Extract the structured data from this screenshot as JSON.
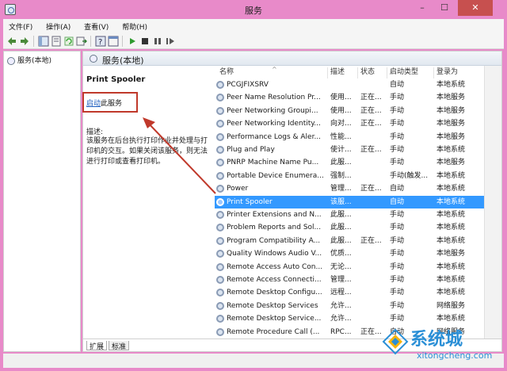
{
  "window": {
    "title": "服务",
    "min": "–",
    "max": "☐",
    "close": "✕"
  },
  "menu": [
    "文件(F)",
    "操作(A)",
    "查看(V)",
    "帮助(H)"
  ],
  "tree": {
    "root": "服务(本地)"
  },
  "main": {
    "header": "服务(本地)",
    "service_title": "Print Spooler",
    "start_link": "启动",
    "start_suffix": "此服务",
    "desc_label": "描述:",
    "desc_text": "该服务在后台执行打印作业并处理与打印机的交互。如果关闭该服务，则无法进行打印或查看打印机。"
  },
  "columns": [
    "名称",
    "描述",
    "状态",
    "启动类型",
    "登录为"
  ],
  "services": [
    {
      "name": "PCGJFIXSRV",
      "desc": "",
      "status": "",
      "start": "自动",
      "logon": "本地系统"
    },
    {
      "name": "Peer Name Resolution Pr...",
      "desc": "使用...",
      "status": "正在...",
      "start": "手动",
      "logon": "本地服务"
    },
    {
      "name": "Peer Networking Groupi...",
      "desc": "使用...",
      "status": "正在...",
      "start": "手动",
      "logon": "本地服务"
    },
    {
      "name": "Peer Networking Identity...",
      "desc": "向对...",
      "status": "正在...",
      "start": "手动",
      "logon": "本地服务"
    },
    {
      "name": "Performance Logs & Aler...",
      "desc": "性能...",
      "status": "",
      "start": "手动",
      "logon": "本地服务"
    },
    {
      "name": "Plug and Play",
      "desc": "使计...",
      "status": "正在...",
      "start": "手动",
      "logon": "本地系统"
    },
    {
      "name": "PNRP Machine Name Pu...",
      "desc": "此服...",
      "status": "",
      "start": "手动",
      "logon": "本地服务"
    },
    {
      "name": "Portable Device Enumera...",
      "desc": "强制...",
      "status": "",
      "start": "手动(触发...",
      "logon": "本地系统"
    },
    {
      "name": "Power",
      "desc": "管理...",
      "status": "正在...",
      "start": "自动",
      "logon": "本地系统"
    },
    {
      "name": "Print Spooler",
      "desc": "该服...",
      "status": "",
      "start": "自动",
      "logon": "本地系统",
      "selected": true
    },
    {
      "name": "Printer Extensions and N...",
      "desc": "此服...",
      "status": "",
      "start": "手动",
      "logon": "本地系统"
    },
    {
      "name": "Problem Reports and Sol...",
      "desc": "此服...",
      "status": "",
      "start": "手动",
      "logon": "本地系统"
    },
    {
      "name": "Program Compatibility A...",
      "desc": "此服...",
      "status": "正在...",
      "start": "手动",
      "logon": "本地系统"
    },
    {
      "name": "Quality Windows Audio V...",
      "desc": "优质...",
      "status": "",
      "start": "手动",
      "logon": "本地服务"
    },
    {
      "name": "Remote Access Auto Con...",
      "desc": "无论...",
      "status": "",
      "start": "手动",
      "logon": "本地系统"
    },
    {
      "name": "Remote Access Connecti...",
      "desc": "管理...",
      "status": "",
      "start": "手动",
      "logon": "本地系统"
    },
    {
      "name": "Remote Desktop Configu...",
      "desc": "远程...",
      "status": "",
      "start": "手动",
      "logon": "本地系统"
    },
    {
      "name": "Remote Desktop Services",
      "desc": "允许...",
      "status": "",
      "start": "手动",
      "logon": "网络服务"
    },
    {
      "name": "Remote Desktop Service...",
      "desc": "允许...",
      "status": "",
      "start": "手动",
      "logon": "本地系统"
    },
    {
      "name": "Remote Procedure Call (...",
      "desc": "RPC...",
      "status": "正在...",
      "start": "自动",
      "logon": "网络服务"
    }
  ],
  "tabs": [
    "扩展",
    "标准"
  ],
  "watermark": {
    "brand": "系统城",
    "url": "xitongcheng.com"
  },
  "colors": {
    "selection": "#3399ff",
    "highlight_box": "#c0392b",
    "link": "#1f5fbf"
  }
}
